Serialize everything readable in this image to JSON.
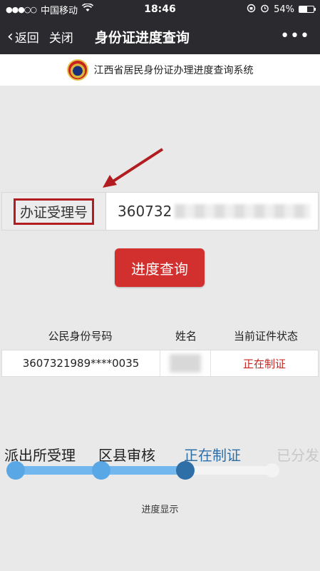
{
  "status_bar": {
    "carrier": "中国移动",
    "time": "18:46",
    "battery": "54%",
    "signal_icon": "signal-dots-icon",
    "wifi_icon": "wifi-icon",
    "battery_level": 0.54
  },
  "nav": {
    "back_label": "返回",
    "close_label": "关闭",
    "title": "身份证进度查询",
    "more_label": "•••"
  },
  "banner": {
    "text": "江西省居民身份证办理进度查询系统"
  },
  "form": {
    "field_label": "办证受理号",
    "field_value": "360732"
  },
  "query_button": {
    "label": "进度查询"
  },
  "table": {
    "headers": [
      "公民身份号码",
      "姓名",
      "当前证件状态"
    ],
    "rows": [
      {
        "id_number": "3607321989****0035",
        "name": "",
        "status": "正在制证"
      }
    ]
  },
  "progress": {
    "steps": [
      {
        "label": "派出所受理",
        "state": "done"
      },
      {
        "label": "区县审核",
        "state": "done"
      },
      {
        "label": "正在制证",
        "state": "current"
      },
      {
        "label": "已分发",
        "state": "pending"
      }
    ],
    "caption": "进度显示"
  },
  "colors": {
    "nav_bg": "#2b2b2f",
    "accent_red": "#d2302e",
    "progress_blue": "#5aa7e6",
    "current_blue": "#2f6fa8"
  }
}
